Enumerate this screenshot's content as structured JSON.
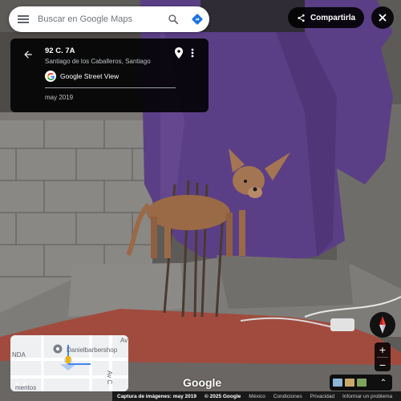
{
  "search": {
    "placeholder": "Buscar en Google Maps"
  },
  "info": {
    "address": "92 C. 7A",
    "locality": "Santiago de los Caballeros, Santiago",
    "source": "Google Street View",
    "date": "may 2019"
  },
  "share": {
    "label": "Compartirla"
  },
  "minimap": {
    "place_label": "Danielbarbershop",
    "street_left": "NDA",
    "street_right_1": "Av",
    "street_right_2": "Av C",
    "bottom_label": "mentos"
  },
  "zoom": {
    "in": "+",
    "out": "−"
  },
  "watermark": "Google",
  "footer": {
    "capture": "Captura de imágenes: may 2019",
    "copyright": "© 2025 Google",
    "country": "México",
    "terms": "Condiciones",
    "privacy": "Privacidad",
    "report": "Informar un problema"
  },
  "colors": {
    "directions_blue": "#1a73e8",
    "tarp_purple": "#5b3f86",
    "panel_bg": "#000000"
  },
  "icons": [
    "menu-icon",
    "search-icon",
    "directions-icon",
    "back-arrow-icon",
    "map-pin-icon",
    "more-vert-icon",
    "google-g-icon",
    "share-icon",
    "close-icon",
    "expand-icon",
    "compass-icon",
    "chevron-up-icon"
  ]
}
